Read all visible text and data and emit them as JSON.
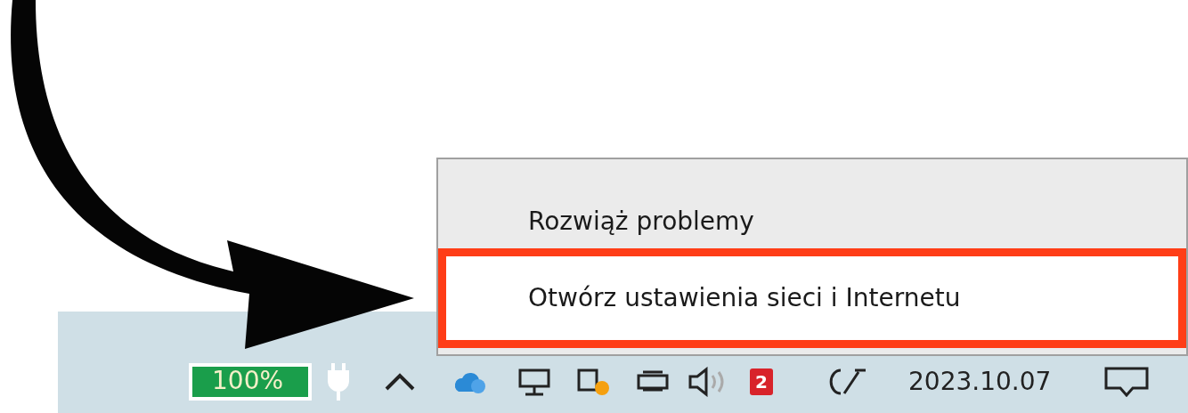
{
  "menu": {
    "items": [
      {
        "label": "Rozwiąż problemy",
        "selected": false
      },
      {
        "label": "Otwórz ustawienia sieci i Internetu",
        "selected": true
      }
    ]
  },
  "taskbar": {
    "battery": {
      "reading": "100%",
      "level": 1
    },
    "tray_badge": "2",
    "date": "2023.10.07"
  }
}
